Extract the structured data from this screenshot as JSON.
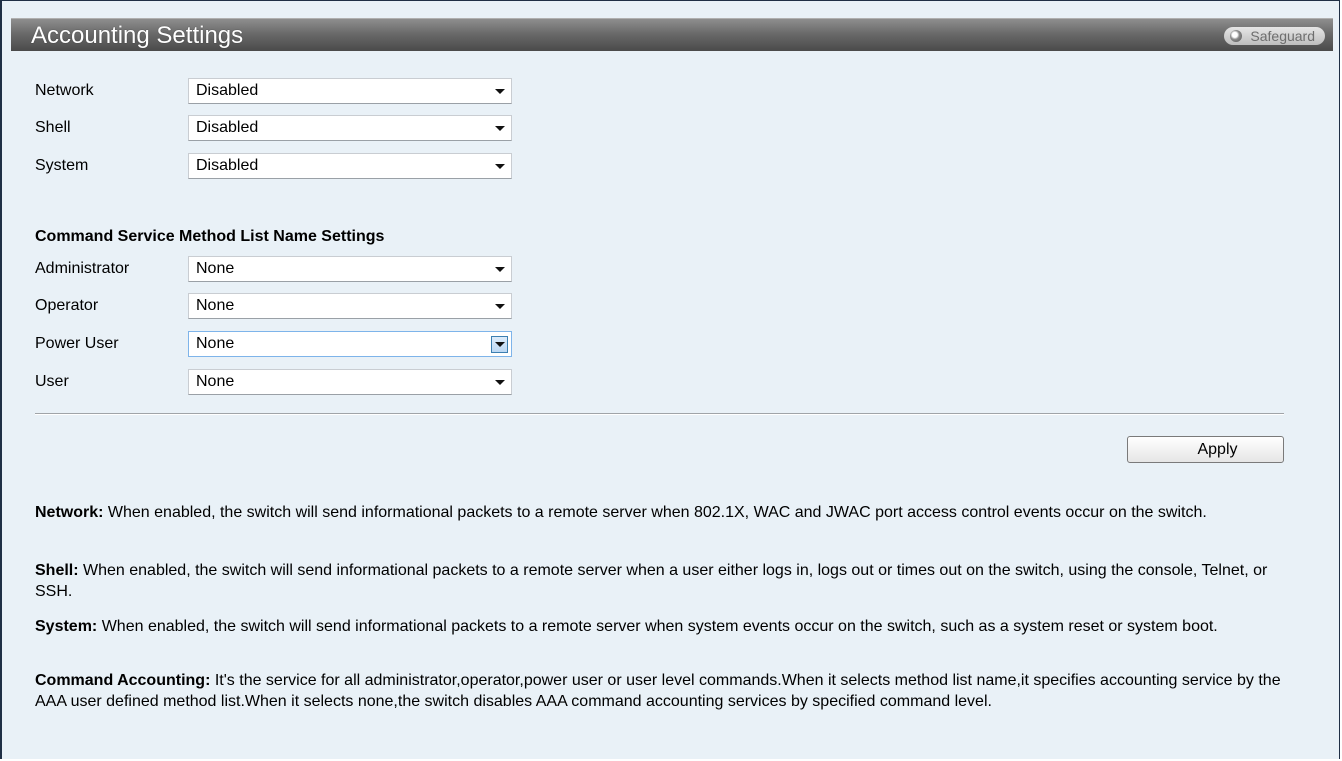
{
  "page": {
    "title": "Accounting Settings",
    "safeguard_label": "Safeguard"
  },
  "accounting": [
    {
      "label": "Network",
      "value": "Disabled"
    },
    {
      "label": "Shell",
      "value": "Disabled"
    },
    {
      "label": "System",
      "value": "Disabled"
    }
  ],
  "command_section": {
    "heading": "Command Service Method List Name Settings",
    "items": [
      {
        "label": "Administrator",
        "value": "None"
      },
      {
        "label": "Operator",
        "value": "None"
      },
      {
        "label": "Power User",
        "value": "None"
      },
      {
        "label": "User",
        "value": "None"
      }
    ]
  },
  "apply_label": "Apply",
  "help": [
    {
      "term": "Network:",
      "text": " When enabled, the switch will send informational packets to a remote server when 802.1X, WAC and JWAC port access control events occur on the switch."
    },
    {
      "term": "Shell:",
      "text": " When enabled, the switch will send informational packets to a remote server when a user either logs in, logs out or times out on the switch, using the console, Telnet, or SSH."
    },
    {
      "term": "System:",
      "text": " When enabled, the switch will send informational packets to a remote server when system events occur on the switch, such as a system reset or system boot."
    },
    {
      "term": "Command Accounting:",
      "text": " It's the service for all administrator,operator,power user or user level commands.When it selects method list name,it specifies accounting service by the AAA user defined method list.When it selects none,the switch disables AAA command accounting services by specified command level."
    }
  ],
  "colors": {
    "background": "#e9f1f7",
    "titlebar": "#6a6a6a",
    "focus_border": "#7eb4ea"
  }
}
